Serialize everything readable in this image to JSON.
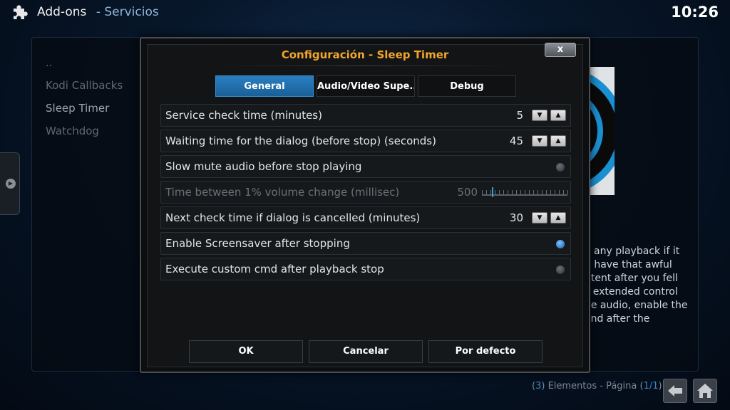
{
  "header": {
    "section": "Add-ons",
    "subsection": "- Servicios",
    "clock": "10:26"
  },
  "background_list": {
    "items": [
      "..",
      "Kodi Callbacks",
      "Sleep Timer",
      "Watchdog"
    ]
  },
  "background_description": {
    "lines": [
      "o any playback if it",
      "u have that awful",
      "ntent after you fell",
      "s extended control",
      "he audio, enable the",
      "and after the"
    ]
  },
  "footer": {
    "open_paren": "(",
    "count": "3",
    "count_suffix": ") Elementos - Página (",
    "page": "1/1",
    "close_paren": ")"
  },
  "dialog": {
    "title": "Configuración - Sleep Timer",
    "close_label": "x",
    "tabs": [
      {
        "label": "General",
        "active": true
      },
      {
        "label": "Audio/Video Supe...",
        "active": false
      },
      {
        "label": "Debug",
        "active": false
      }
    ],
    "settings": [
      {
        "label": "Service check time (minutes)",
        "value": "5",
        "type": "spinner"
      },
      {
        "label": "Waiting time for the dialog (before stop) (seconds)",
        "value": "45",
        "type": "spinner"
      },
      {
        "label": "Slow mute audio before stop playing",
        "type": "toggle",
        "checked": false
      },
      {
        "label": "Time between 1% volume change  (millisec)",
        "value": "500",
        "type": "slider",
        "disabled": true,
        "slider_fraction": 0.12
      },
      {
        "label": "Next check time if dialog is cancelled (minutes)",
        "value": "30",
        "type": "spinner"
      },
      {
        "label": "Enable Screensaver after stopping",
        "type": "toggle",
        "checked": true
      },
      {
        "label": "Execute custom cmd after playback stop",
        "type": "toggle",
        "checked": false
      }
    ],
    "buttons": {
      "ok": "OK",
      "cancel": "Cancelar",
      "default": "Por defecto"
    }
  },
  "colors": {
    "accent": "#2a7fc1",
    "title": "#f0a62a"
  },
  "icons": {
    "header": "puzzle-icon",
    "back": "back-arrow-icon",
    "home": "home-icon"
  }
}
